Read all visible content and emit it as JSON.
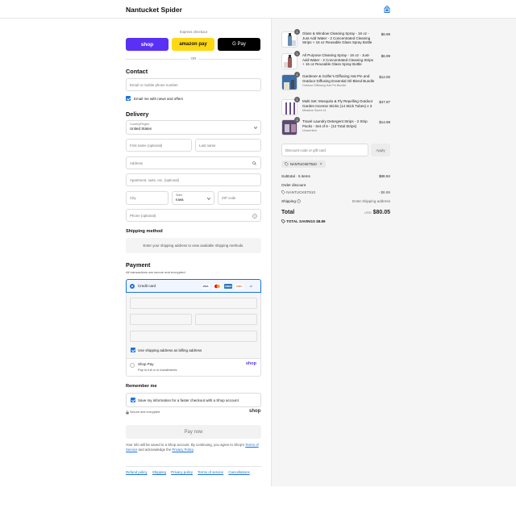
{
  "header": {
    "brand": "Nantucket Spider"
  },
  "express": {
    "label": "Express checkout",
    "shop": "shop",
    "amazon": "amazon pay",
    "gpay": "G Pay",
    "or": "OR"
  },
  "contact": {
    "title": "Contact",
    "email_placeholder": "Email or mobile phone number",
    "news_label": "Email me with news and offers"
  },
  "delivery": {
    "title": "Delivery",
    "country_label": "Country/Region",
    "country_value": "United States",
    "first_name": "First name (optional)",
    "last_name": "Last name",
    "address": "Address",
    "apartment": "Apartment, suite, etc. (optional)",
    "city": "City",
    "state_label": "State",
    "state_value": "Iowa",
    "zip": "ZIP code",
    "phone": "Phone (optional)"
  },
  "shipping": {
    "title": "Shipping method",
    "message": "Enter your shipping address to view available shipping methods."
  },
  "payment": {
    "title": "Payment",
    "subtitle": "All transactions are secure and encrypted.",
    "credit_card": "Credit card",
    "card_brands": [
      "VISA",
      "MC",
      "AMEX",
      "DISC",
      "+5"
    ],
    "billing_label": "Use shipping address as billing address",
    "shoppay_title": "Shop Pay",
    "shoppay_sub": "Pay in full or in installments",
    "shoppay_logo": "shop"
  },
  "remember": {
    "title": "Remember me",
    "save_label": "Save my information for a faster checkout with a Shop account",
    "secure": "Secure and encrypted",
    "shop_logo": "shop"
  },
  "pay_now": "Pay now",
  "legal": {
    "text1": "Your info will be saved to a Shop account. By continuing, you agree to Shop's",
    "terms": "Terms of Service",
    "text2": "and acknowledge the",
    "privacy": "Privacy Policy",
    "end": "."
  },
  "footer": [
    "Refund policy",
    "Shipping",
    "Privacy policy",
    "Terms of service",
    "Cancellations"
  ],
  "cart": {
    "items": [
      {
        "qty": "1",
        "name": "Glass & Window Cleaning Spray - 16 oz - Just Add Water - 2 Concentrated Cleaning Strips + 16 oz Reusable Glass Spray Bottle",
        "sub": "",
        "price": "$6.99"
      },
      {
        "qty": "1",
        "name": "All Purpose Cleaning Spray - 16 oz - Just-Add-Water - 2 Concentrated Cleaning Strips + 16 oz Reusable Glass Spray Bottle",
        "sub": "",
        "price": "$6.99"
      },
      {
        "qty": "1",
        "name": "Gardener & Golfer's Diffusing Hat Pin and Outdoor Diffusing Essential Oil Blend Bundle",
        "sub": "Outdoor Diffusing Hat Pin Bundle",
        "price": "$12.00"
      },
      {
        "qty": "1",
        "name": "Multi Set: Mosquito & Fly Repelling Outdoor Garden Incense Sticks (14 Stick Tubes) x 3",
        "sub": "Meadow Scent x3",
        "price": "$47.97"
      },
      {
        "qty": "1",
        "name": "Travel Laundry Detergent Strips - 2 Strip Packs - Set of 6 - (12 Total Strips)",
        "sub": "Unscented",
        "price": "$14.99"
      }
    ],
    "discount_placeholder": "Discount code or gift card",
    "apply": "Apply",
    "code_tag": "NANTUCKET510",
    "subtotal_label": "Subtotal · 5 items",
    "subtotal_value": "$88.94",
    "order_discount_label": "Order discount",
    "code_line": "NANTUCKET510",
    "discount_value": "- $8.89",
    "shipping_label": "Shipping",
    "shipping_value": "Enter shipping address",
    "total_label": "Total",
    "currency": "USD",
    "total_value": "$80.05",
    "savings_label": "TOTAL SAVINGS",
    "savings_value": "$8.89"
  },
  "colors": {
    "accent": "#1a73d9",
    "shop": "#5a31f4",
    "amazon": "#ffd814"
  }
}
